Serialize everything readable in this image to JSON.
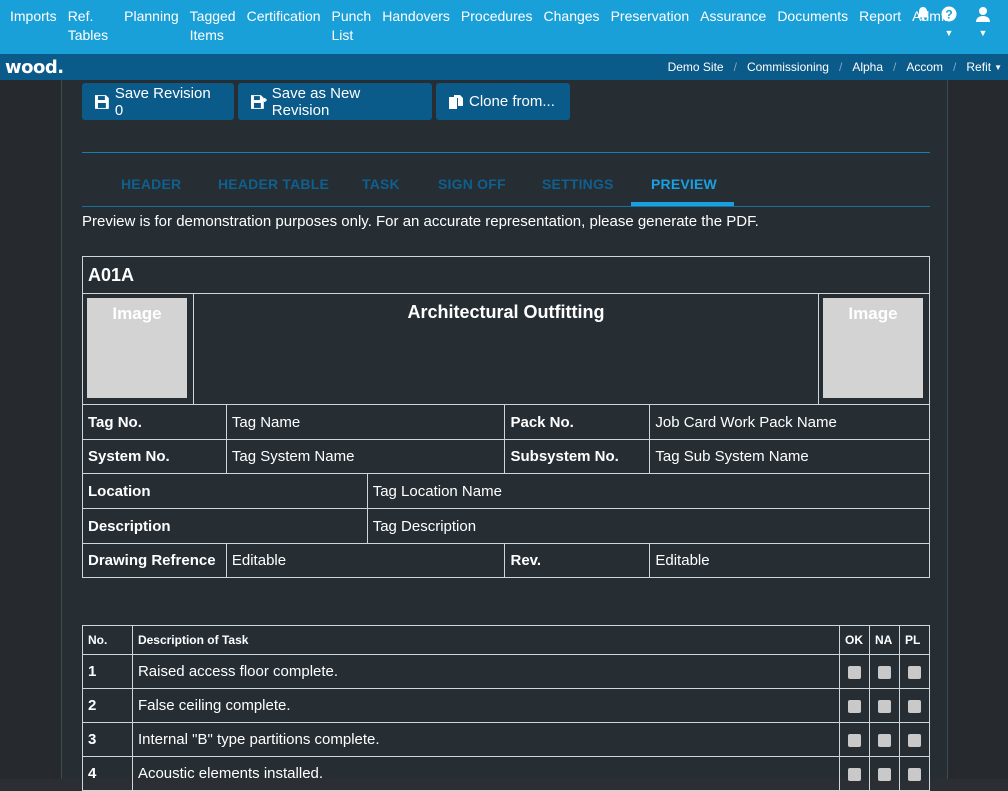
{
  "nav": {
    "items": [
      "Imports",
      "Ref.\nTables",
      "Planning",
      "Tagged\nItems",
      "Certification",
      "Punch\nList",
      "Handovers",
      "Procedures",
      "Changes",
      "Preservation",
      "Assurance",
      "Documents",
      "Report",
      "Admin"
    ]
  },
  "brand": {
    "logo": "wood."
  },
  "breadcrumb": {
    "items": [
      "Demo Site",
      "Commissioning",
      "Alpha",
      "Accom"
    ],
    "last": "Refit"
  },
  "toolbar": {
    "save_label": "Save Revision 0",
    "save_new_label": "Save as New Revision",
    "clone_label": "Clone from..."
  },
  "tabs": [
    "HEADER",
    "HEADER TABLE",
    "TASK",
    "SIGN OFF",
    "SETTINGS",
    "PREVIEW"
  ],
  "preview": {
    "note": "Preview is for demonstration purposes only. For an accurate representation, please generate the PDF.",
    "code": "A01A",
    "image_label": "Image",
    "title": "Architectural Outfitting",
    "fields": {
      "tag_no_label": "Tag No.",
      "tag_no_value": "Tag Name",
      "pack_no_label": "Pack No.",
      "pack_no_value": "Job Card Work Pack Name",
      "system_no_label": "System No.",
      "system_no_value": "Tag System Name",
      "subsystem_no_label": "Subsystem No.",
      "subsystem_no_value": "Tag Sub System Name",
      "location_label": "Location",
      "location_value": "Tag Location Name",
      "description_label": "Description",
      "description_value": "Tag Description",
      "drawing_label": "Drawing Refrence",
      "drawing_value": "Editable",
      "rev_label": "Rev.",
      "rev_value": "Editable"
    },
    "task_table": {
      "headers": {
        "no": "No.",
        "desc": "Description of Task",
        "ok": "OK",
        "na": "NA",
        "pl": "PL"
      },
      "rows": [
        {
          "no": "1",
          "desc": "Raised access floor complete."
        },
        {
          "no": "2",
          "desc": "False ceiling complete."
        },
        {
          "no": "3",
          "desc": "Internal \"B\" type partitions complete."
        },
        {
          "no": "4",
          "desc": "Acoustic elements installed."
        }
      ]
    }
  },
  "colors": {
    "nav": "#1aa0d8",
    "subbar": "#0a5a8a",
    "accent": "#1a9fe0",
    "background": "#2b2f33"
  }
}
